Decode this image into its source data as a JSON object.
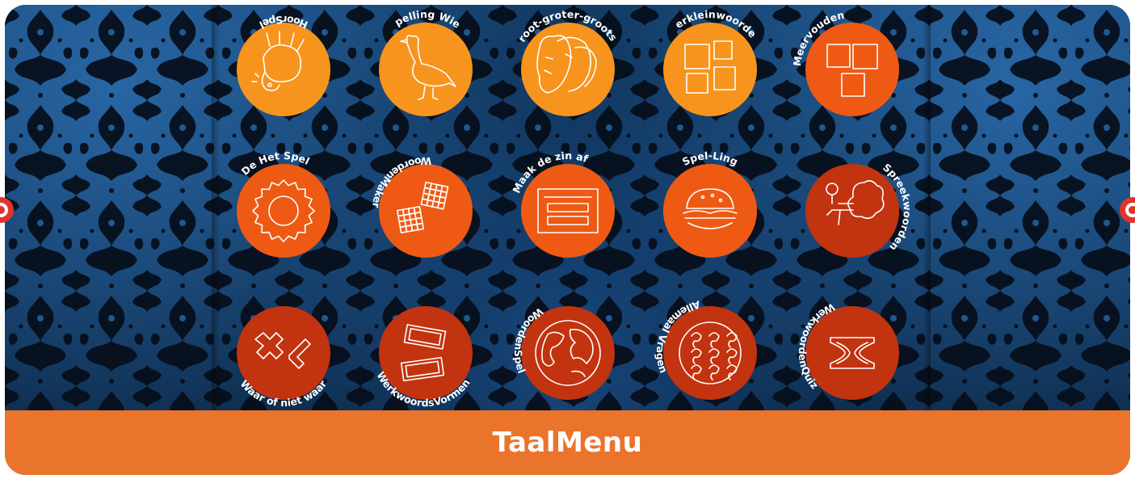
{
  "menu": {
    "title": "TaalMenu"
  },
  "colors": {
    "orange_light": "#f7941d",
    "orange_mid": "#ee5a14",
    "red_dark": "#c2330f",
    "footer": "#ea742b",
    "icon_line": "#ffffff"
  },
  "games": [
    {
      "label": "HoorSpel",
      "icon": "upside-down-cow-icon",
      "color": "#f7941d"
    },
    {
      "label": "Spelling Wiel",
      "icon": "goose-icon",
      "color": "#f7941d"
    },
    {
      "label": "Groot-groter-grootst",
      "icon": "elephants-icon",
      "color": "#f7941d"
    },
    {
      "label": "Verkleinwoorden",
      "icon": "small-squares-icon",
      "color": "#f7941d"
    },
    {
      "label": "Meervouden",
      "icon": "three-squares-icon",
      "color": "#ee5a14"
    },
    {
      "label": "De Het Spel",
      "icon": "gear-icon",
      "color": "#ee5a14"
    },
    {
      "label": "WoordenMaker",
      "icon": "crossword-grid-icon",
      "color": "#ee5a14"
    },
    {
      "label": "Maak de zin af",
      "icon": "sentence-box-icon",
      "color": "#ee5a14"
    },
    {
      "label": "Spel-Ling",
      "icon": "hamburger-icon",
      "color": "#ee5a14"
    },
    {
      "label": "Spreekwoorden",
      "icon": "broccoli-icon",
      "color": "#c2330f"
    },
    {
      "label": "Waar of niet waar",
      "icon": "cross-check-icon",
      "color": "#c2330f"
    },
    {
      "label": "WerkwoordsVormen",
      "icon": "word-tiles-icon",
      "color": "#c2330f"
    },
    {
      "label": "WoordenSpel",
      "icon": "globe-icon",
      "color": "#c2330f"
    },
    {
      "label": "Allemaal Vragen",
      "icon": "question-pattern-icon",
      "color": "#c2330f"
    },
    {
      "label": "WerkwoordenQuiz",
      "icon": "hourglass-icon",
      "color": "#c2330f"
    }
  ],
  "nav": {
    "prev_icon": "prev-page-icon",
    "next_icon": "next-page-icon"
  }
}
